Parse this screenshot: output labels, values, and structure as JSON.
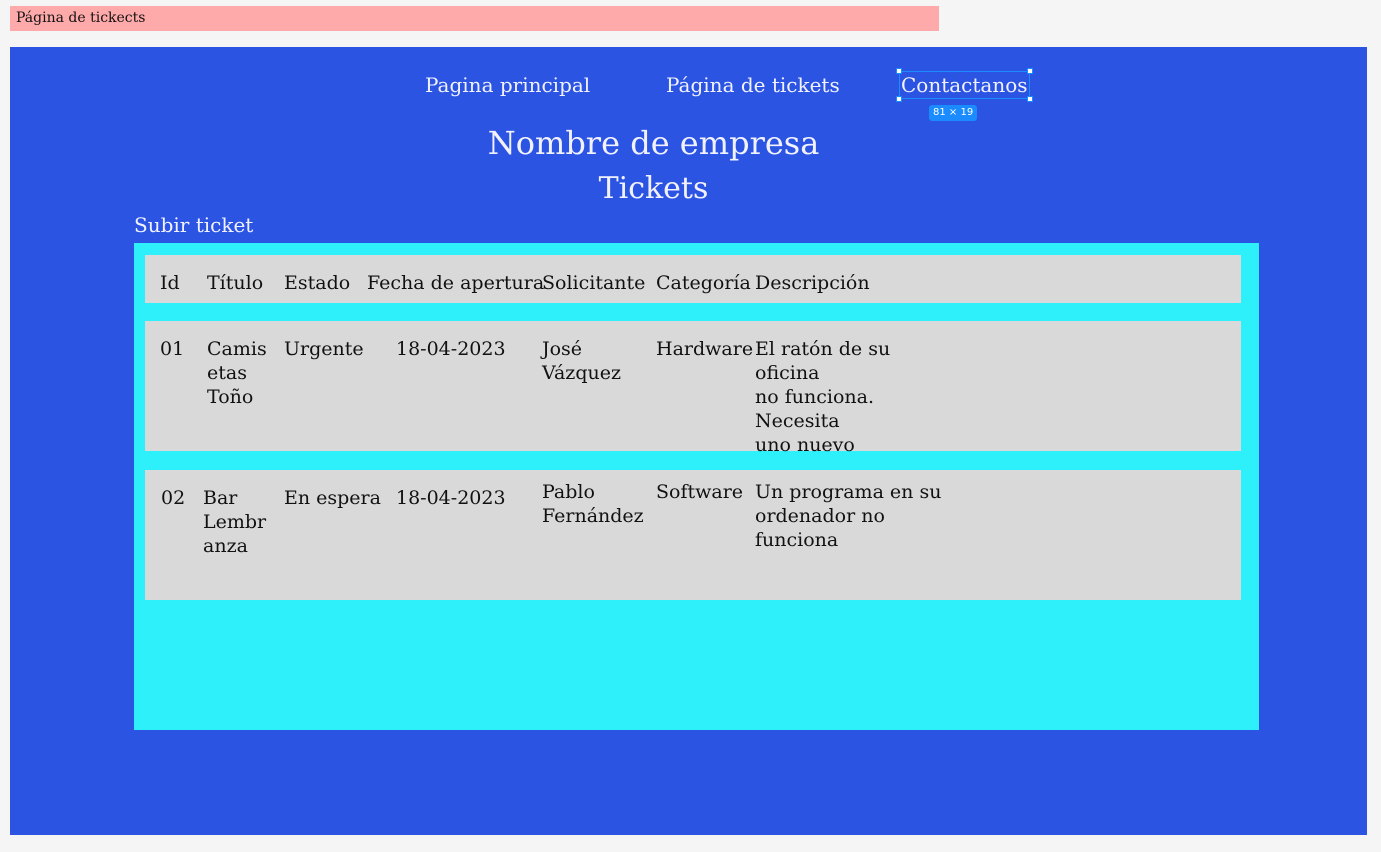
{
  "frame_label": "Página de tickects",
  "nav": {
    "items": [
      {
        "label": "Pagina principal"
      },
      {
        "label": "Página de tickets"
      },
      {
        "label": "Contactanos"
      }
    ],
    "selection_badge": "81 × 19"
  },
  "company_name": "Nombre de empresa",
  "section_title": "Tickets",
  "upload_label": "Subir ticket",
  "table": {
    "headers": [
      "Id",
      "Título",
      "Estado",
      "Fecha de apertura",
      "Solicitante",
      "Categoría",
      "Descripción"
    ],
    "rows": [
      {
        "id": "01",
        "title": "Camis\netas\nToño",
        "state": "Urgente",
        "date": "18-04-2023",
        "requester": "José\nVázquez",
        "category": "Hardware",
        "description": "El ratón de su oficina\nno funciona. Necesita\nuno nuevo"
      },
      {
        "id": "02",
        "title": "Bar\nLembr\nanza",
        "state": "En espera",
        "date": "18-04-2023",
        "requester": "Pablo\nFernández",
        "category": "Software",
        "description": "Un programa en su\nordenador no\nfunciona"
      }
    ]
  },
  "colors": {
    "frame_background": "#2b54e3",
    "panel_background": "#2ef0fb",
    "row_background": "#d9d9d9",
    "label_background": "#ffaaaa",
    "selection": "#1a8cff"
  }
}
